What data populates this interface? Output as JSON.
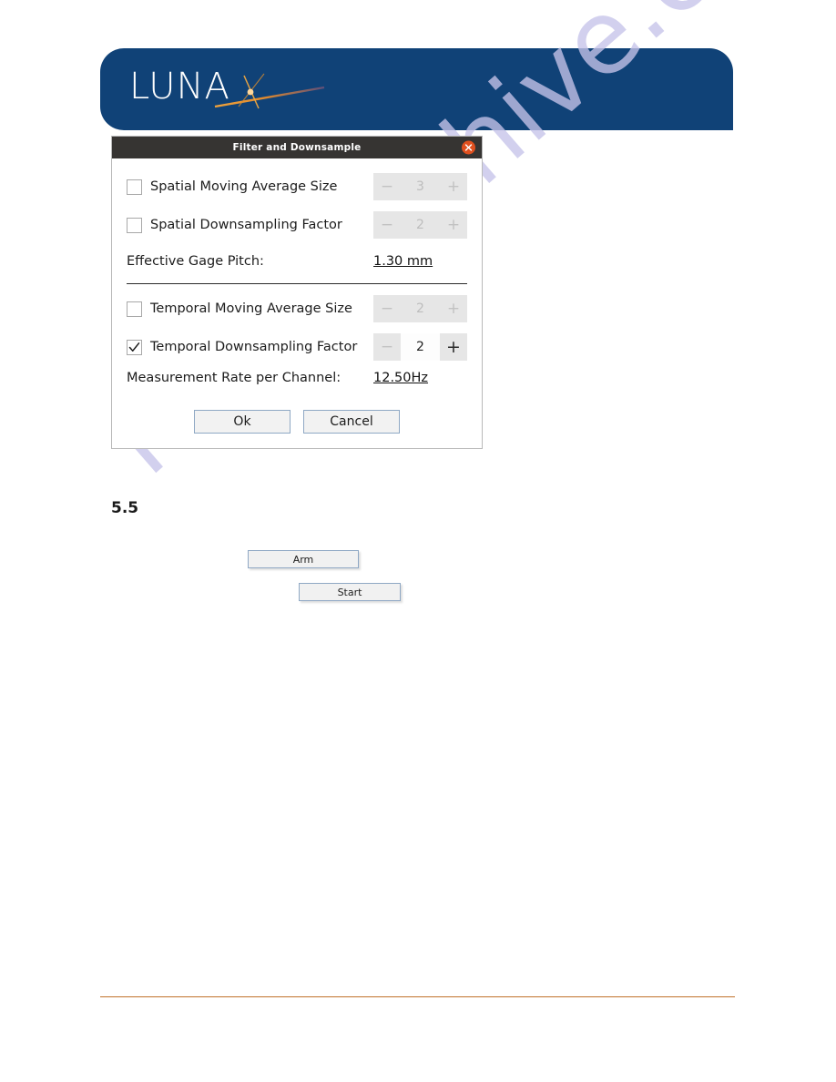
{
  "page": {
    "watermark": "manualshive.com",
    "footer_rule_color": "#c1722c",
    "banner_color": "#104277"
  },
  "header": {
    "logo_text": "LUNA",
    "logo_icon": "starburst-icon"
  },
  "dialog": {
    "title": "Filter and Downsample",
    "close_icon": "close-icon",
    "spatial": {
      "rows": [
        {
          "label": "Spatial Moving Average Size",
          "checked": false,
          "enabled": false,
          "value": "3",
          "minus": "−",
          "plus": "+"
        },
        {
          "label": "Spatial Downsampling Factor",
          "checked": false,
          "enabled": false,
          "value": "2",
          "minus": "−",
          "plus": "+"
        }
      ],
      "readout_label": "Effective Gage Pitch:",
      "readout_value": "1.30 mm"
    },
    "temporal": {
      "rows": [
        {
          "label": "Temporal Moving Average Size",
          "checked": false,
          "enabled": false,
          "value": "2",
          "minus": "−",
          "plus": "+"
        },
        {
          "label": "Temporal Downsampling Factor",
          "checked": true,
          "enabled": true,
          "value": "2",
          "minus": "−",
          "plus": "+"
        }
      ],
      "readout_label": "Measurement Rate per Channel:",
      "readout_value": "12.50Hz"
    },
    "ok_label": "Ok",
    "cancel_label": "Cancel"
  },
  "section": {
    "number": "5.5"
  },
  "controls": {
    "arm_label": "Arm",
    "start_label": "Start"
  }
}
